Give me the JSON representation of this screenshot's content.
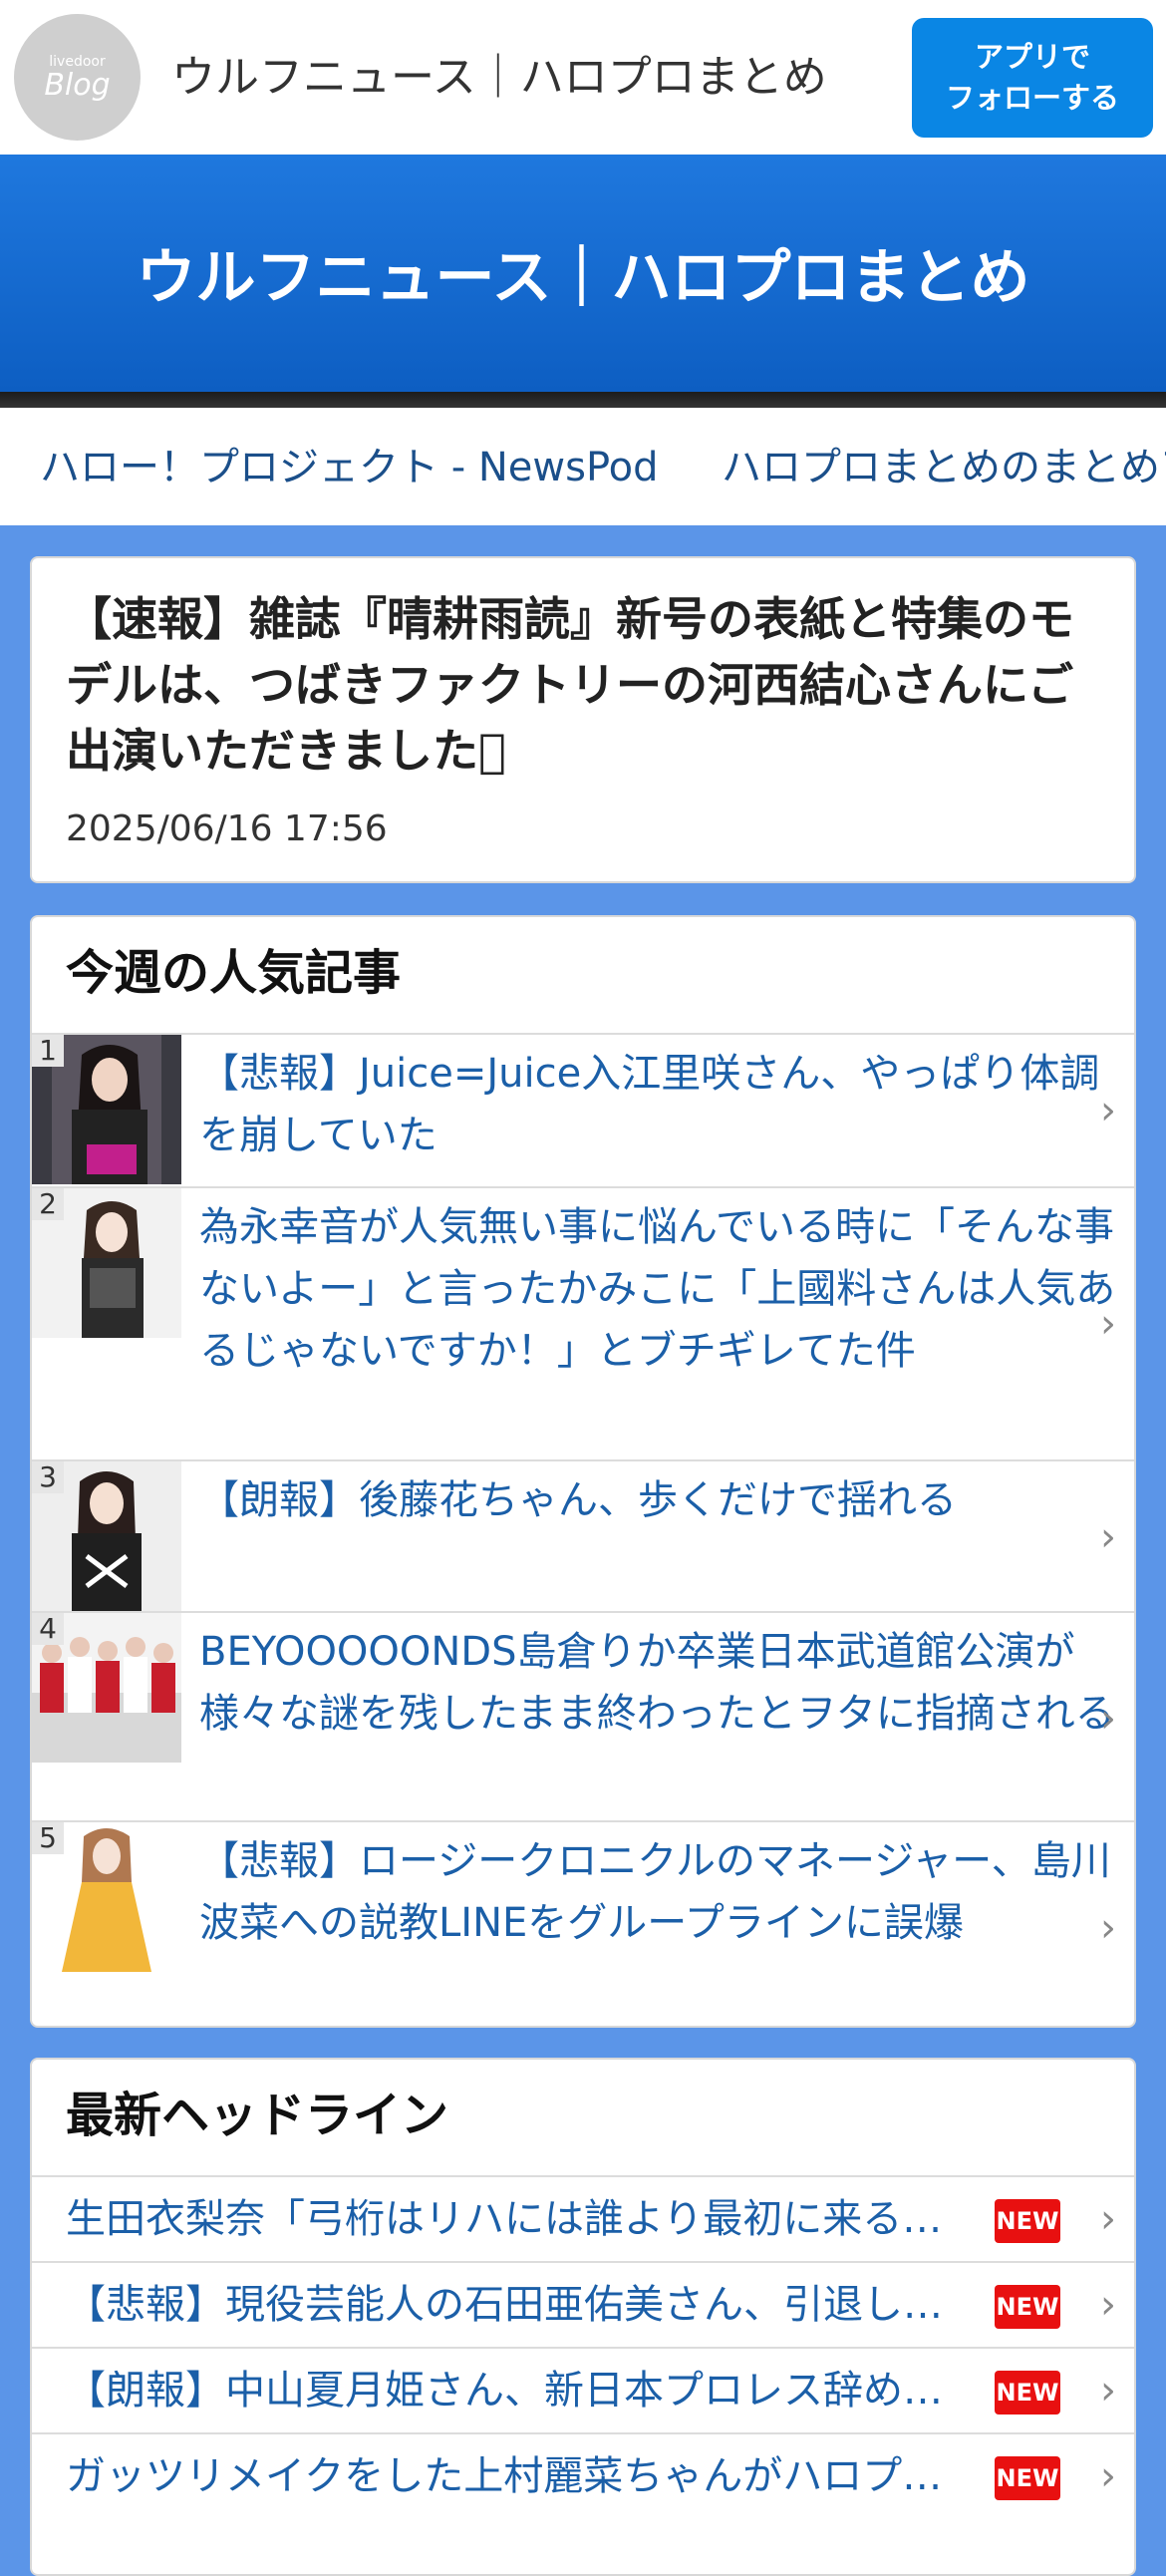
{
  "header": {
    "logo_small": "livedoor",
    "logo_big": "Blog",
    "site_title": "ウルフニュース｜ハロプロまとめ",
    "follow_line1": "アプリで",
    "follow_line2": "フォローする"
  },
  "banner": {
    "title": "ウルフニュース｜ハロプロまとめ"
  },
  "links": [
    "ハロー！プロジェクト - NewsPod",
    "ハロプロまとめのまとめア"
  ],
  "article": {
    "title": "【速報】雑誌『晴耕雨読』新号の表紙と特集のモデルは、つばきファクトリーの河西結心さんにご出演いただきました􀀀",
    "date": "2025/06/16 17:56"
  },
  "popular": {
    "heading": "今週の人気記事",
    "items": [
      {
        "rank": "1",
        "title": "【悲報】Juice=Juice入江里咲さん、やっぱり体調を崩していた"
      },
      {
        "rank": "2",
        "title": "為永幸音が人気無い事に悩んでいる時に「そんな事ないよー」と言ったかみこに「上國料さんは人気あるじゃないですか！」とブチギレてた件"
      },
      {
        "rank": "3",
        "title": "【朗報】後藤花ちゃん、歩くだけで揺れる"
      },
      {
        "rank": "4",
        "title": "BEYOOOOONDS島倉りか卒業日本武道館公演が様々な謎を残したまま終わったとヲタに指摘される"
      },
      {
        "rank": "5",
        "title": "【悲報】ロージークロニクルのマネージャー、島川波菜への説教LINEをグループラインに誤爆"
      }
    ]
  },
  "headlines": {
    "heading": "最新ヘッドライン",
    "new_label": "NEW",
    "items": [
      "生田衣梨奈「弓桁はリハには誰より最初に来る…",
      "【悲報】現役芸能人の石田亜佑美さん、引退し…",
      "【朗報】中山夏月姫さん、新日本プロレス辞め…",
      "ガッツリメイクをした上村麗菜ちゃんがハロプ…"
    ]
  },
  "colors": {
    "accent": "#0a86e4",
    "banner": "#1f78de",
    "background": "#5b95e8",
    "link": "#1b5fa8",
    "new_badge": "#e81010"
  },
  "icons": {
    "chevron": "chevron-right-icon"
  }
}
